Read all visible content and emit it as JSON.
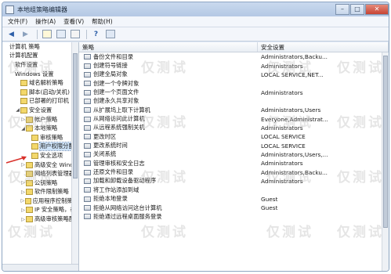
{
  "window": {
    "title": "本地组策略编辑器",
    "controls": [
      "–",
      "□",
      "✕"
    ]
  },
  "menubar": {
    "items": [
      "文件(F)",
      "操作(A)",
      "查看(V)",
      "帮助(H)"
    ]
  },
  "toolbar": {
    "buttons": [
      "back-icon",
      "forward-icon",
      "folder-up-icon",
      "show-hide-tree-icon",
      "properties-icon",
      "help-icon",
      "filter-icon"
    ]
  },
  "tree": {
    "items": [
      {
        "label": "计算机 策略",
        "indent": 0,
        "expander": ""
      },
      {
        "label": "计算机配置",
        "indent": 0,
        "expander": ""
      },
      {
        "label": "软件设置",
        "indent": 1,
        "expander": ""
      },
      {
        "label": "Windows 设置",
        "indent": 1,
        "expander": ""
      },
      {
        "label": "域名解析策略",
        "indent": 2,
        "expander": ""
      },
      {
        "label": "脚本(启动/关机)",
        "indent": 2,
        "expander": ""
      },
      {
        "label": "已部署的打印机",
        "indent": 2,
        "expander": ""
      },
      {
        "label": "安全设置",
        "indent": 2,
        "expander": "◢"
      },
      {
        "label": "帐户策略",
        "indent": 3,
        "expander": "▷"
      },
      {
        "label": "本地策略",
        "indent": 3,
        "expander": "◢"
      },
      {
        "label": "审核策略",
        "indent": 4,
        "expander": ""
      },
      {
        "label": "用户权限分配",
        "indent": 4,
        "expander": "",
        "selected": true
      },
      {
        "label": "安全选项",
        "indent": 4,
        "expander": ""
      },
      {
        "label": "高级安全 Wind",
        "indent": 3,
        "expander": "▷"
      },
      {
        "label": "网络列表管理器",
        "indent": 3,
        "expander": ""
      },
      {
        "label": "公钥策略",
        "indent": 3,
        "expander": "▷"
      },
      {
        "label": "软件限制策略",
        "indent": 3,
        "expander": "▷"
      },
      {
        "label": "应用程序控制策略",
        "indent": 3,
        "expander": "▷"
      },
      {
        "label": "IP 安全策略，在",
        "indent": 3,
        "expander": "▷"
      },
      {
        "label": "高级审核策略配",
        "indent": 3,
        "expander": "▷"
      }
    ]
  },
  "list": {
    "columns": {
      "policy": "策略",
      "setting": "安全设置"
    },
    "rows": [
      {
        "policy": "备份文件和目录",
        "setting": "Administrators,Backu..."
      },
      {
        "policy": "创建符号链接",
        "setting": "Administrators"
      },
      {
        "policy": "创建全局对象",
        "setting": "LOCAL SERVICE,NET..."
      },
      {
        "policy": "创建一个令牌对象",
        "setting": ""
      },
      {
        "policy": "创建一个页面文件",
        "setting": "Administrators"
      },
      {
        "policy": "创建永久共享对象",
        "setting": ""
      },
      {
        "policy": "从扩展坞上取下计算机",
        "setting": "Administrators,Users"
      },
      {
        "policy": "从网络访问此计算机",
        "setting": "Everyone,Administrat..."
      },
      {
        "policy": "从远程系统强制关机",
        "setting": "Administrators"
      },
      {
        "policy": "更改时区",
        "setting": "LOCAL SERVICE"
      },
      {
        "policy": "更改系统时间",
        "setting": "LOCAL SERVICE"
      },
      {
        "policy": "关闭系统",
        "setting": "Administrators,Users,..."
      },
      {
        "policy": "管理审核和安全日志",
        "setting": "Administrators"
      },
      {
        "policy": "还原文件和目录",
        "setting": "Administrators,Backu..."
      },
      {
        "policy": "加载和卸载设备驱动程序",
        "setting": "Administrators"
      },
      {
        "policy": "将工作站添加到域",
        "setting": ""
      },
      {
        "policy": "拒绝本地登录",
        "setting": "Guest"
      },
      {
        "policy": "拒绝从网络访问这台计算机",
        "setting": "Guest"
      },
      {
        "policy": "拒绝通过远程桌面服务登录",
        "setting": ""
      }
    ]
  },
  "watermark": "仅测试",
  "colors": {
    "accent": "#cde2f7",
    "titlebar": "#b4c8e4",
    "arrow": "#d9312b"
  }
}
